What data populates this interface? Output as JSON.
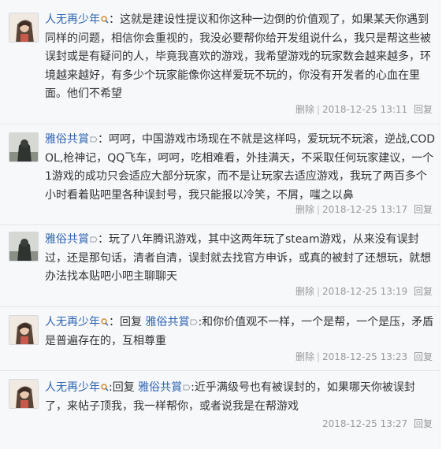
{
  "badges": {
    "level_badge_icon": "magnifier-badge-icon",
    "tag_badge_icon": "tag-badge-icon"
  },
  "replies": [
    {
      "avatar": "avatar-icon",
      "user": "人无再少年",
      "text": "：这就是建设性提议和你这种一边倒的价值观了，如果某天你遇到同样的问题，相信你会重视的，我没必要帮你给开发组说什么，我只是帮这些被误封或是有疑问的人，毕竟我喜欢的游戏，我希望游戏的玩家数会越来越多，环境越来越好，有多少个玩家能像你这样爱玩不玩的，你没有开发者的心血在里面。他们不希望",
      "delete": "删除",
      "time": "2018-12-25 13:11",
      "reply": "回复"
    },
    {
      "avatar": "avatar-icon",
      "user": "雅俗共賞",
      "text": "：呵呵，中国游戏市场现在不就是这样吗，爱玩玩不玩滚，逆战,CODOL,枪神记，QQ飞车，呵呵，吃相难看，外挂满天，不采取任何玩家建议，一个1游戏的成功只会适应大部分玩家，而不是让玩家去适应游戏，我玩了两百多个小时看着贴吧里各种误封号，我只能报以冷笑，不屑，嗤之以鼻",
      "delete": "删除",
      "time": "2018-12-25 13:17",
      "reply": "回复"
    },
    {
      "avatar": "avatar-icon",
      "user": "雅俗共賞",
      "text": "：玩了八年腾讯游戏，其中这两年玩了steam游戏，从来没有误封过，还是那句话，清者自清，误封就去找官方申诉，或真的被封了还想玩，就想办法找本贴吧小吧主聊聊天",
      "delete": "删除",
      "time": "2018-12-25 13:19",
      "reply": "回复"
    },
    {
      "avatar": "avatar-icon",
      "user": "人无再少年",
      "prefix": "：回复 ",
      "target": "雅俗共賞",
      "text": ":和你价值观不一样，一个是帮，一个是压，矛盾是普遍存在的，互相尊重",
      "delete": "删除",
      "time": "2018-12-25 13:23",
      "reply": "回复"
    },
    {
      "avatar": "avatar-icon",
      "user": "人无再少年",
      "prefix": ":回复 ",
      "target": "雅俗共賞",
      "text": ":近乎满级号也有被误封的，如果哪天你被误封了，来帖子顶我，我一样帮你，或者说我是在帮游戏",
      "time": "2018-12-25 13:27",
      "reply": "回复"
    }
  ]
}
